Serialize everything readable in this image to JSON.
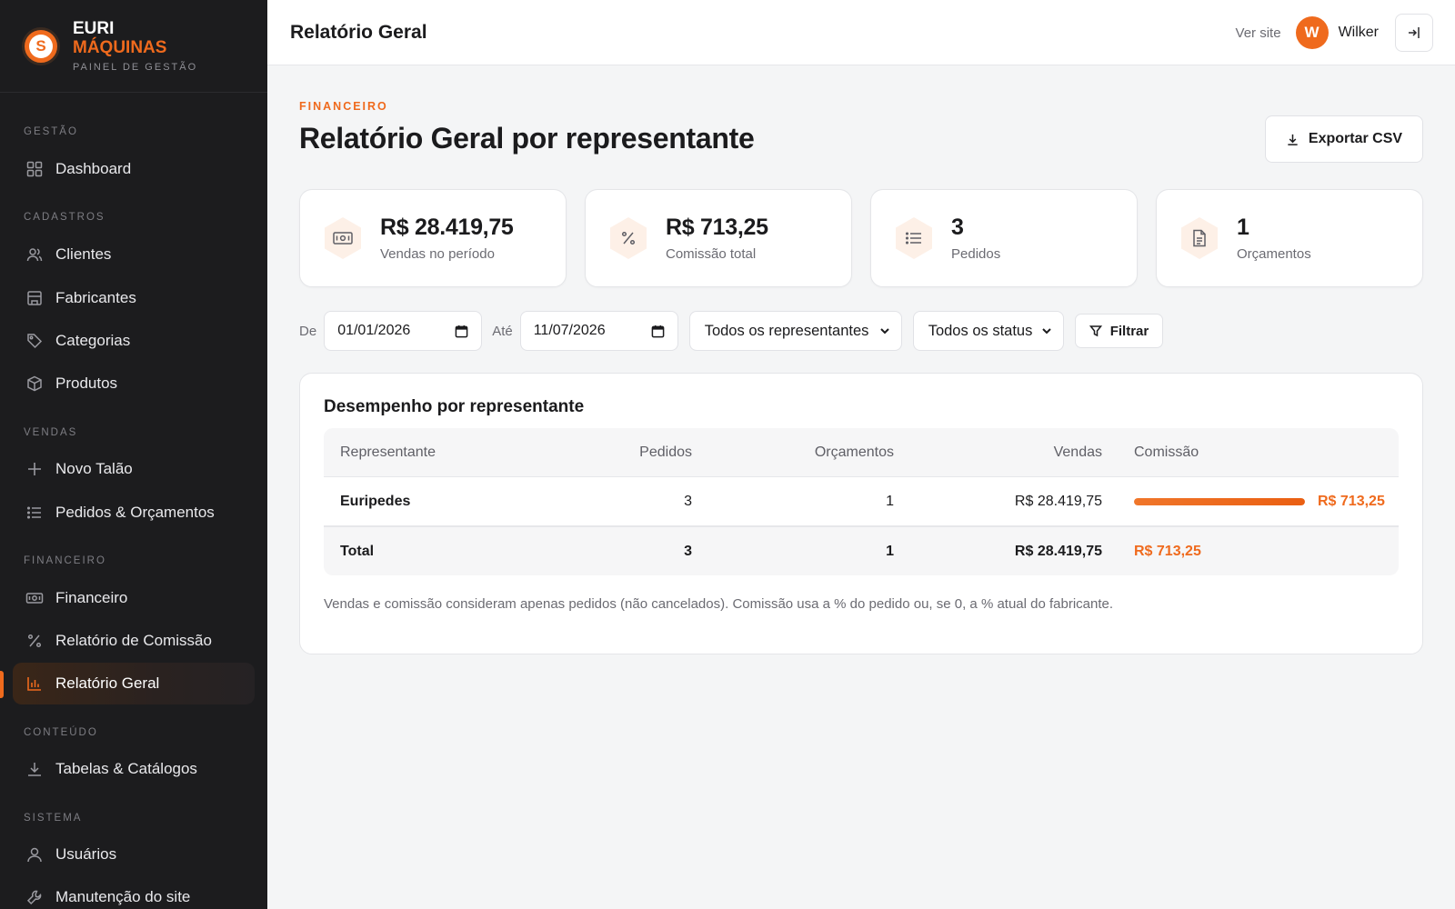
{
  "brand": {
    "line1": "EURI",
    "line2": "MÁQUINAS",
    "tagline": "PAINEL DE GESTÃO",
    "logo_letter": "S",
    "accent": "#ef6a1d"
  },
  "sidebar": {
    "sections": [
      {
        "label": "GESTÃO",
        "items": [
          {
            "label": "Dashboard",
            "icon": "grid-icon"
          }
        ]
      },
      {
        "label": "CADASTROS",
        "items": [
          {
            "label": "Clientes",
            "icon": "users-icon"
          },
          {
            "label": "Fabricantes",
            "icon": "building-icon"
          },
          {
            "label": "Categorias",
            "icon": "tag-icon"
          },
          {
            "label": "Produtos",
            "icon": "box-icon"
          }
        ]
      },
      {
        "label": "VENDAS",
        "items": [
          {
            "label": "Novo Talão",
            "icon": "plus-icon"
          },
          {
            "label": "Pedidos & Orçamentos",
            "icon": "list-icon"
          }
        ]
      },
      {
        "label": "FINANCEIRO",
        "items": [
          {
            "label": "Financeiro",
            "icon": "banknote-icon"
          },
          {
            "label": "Relatório de Comissão",
            "icon": "percent-icon"
          },
          {
            "label": "Relatório Geral",
            "icon": "bar-chart-icon",
            "active": true
          }
        ]
      },
      {
        "label": "CONTEÚDO",
        "items": [
          {
            "label": "Tabelas & Catálogos",
            "icon": "download-icon"
          }
        ]
      },
      {
        "label": "SISTEMA",
        "items": [
          {
            "label": "Usuários",
            "icon": "user-icon"
          },
          {
            "label": "Manutenção do site",
            "icon": "wrench-icon"
          }
        ]
      }
    ]
  },
  "topbar": {
    "title": "Relatório Geral",
    "view_site": "Ver site",
    "avatar_initial": "W",
    "user_name": "Wilker"
  },
  "header": {
    "eyebrow": "FINANCEIRO",
    "title": "Relatório Geral por representante",
    "export_label": "Exportar CSV"
  },
  "stats": [
    {
      "value": "R$ 28.419,75",
      "label": "Vendas no período",
      "icon": "banknote-icon"
    },
    {
      "value": "R$ 713,25",
      "label": "Comissão total",
      "icon": "percent-icon"
    },
    {
      "value": "3",
      "label": "Pedidos",
      "icon": "list-icon"
    },
    {
      "value": "1",
      "label": "Orçamentos",
      "icon": "document-icon"
    }
  ],
  "filters": {
    "from_label": "De",
    "from_value": "01/01/2026",
    "to_label": "Até",
    "to_value": "11/07/2026",
    "representative_selected": "Todos os representantes",
    "status_selected": "Todos os status",
    "filter_label": "Filtrar"
  },
  "performance": {
    "title": "Desempenho por representante",
    "columns": [
      "Representante",
      "Pedidos",
      "Orçamentos",
      "Vendas",
      "Comissão"
    ],
    "rows": [
      {
        "name": "Euripedes",
        "orders": "3",
        "quotes": "1",
        "sales": "R$ 28.419,75",
        "commission": "R$ 713,25",
        "commission_share": 1.0
      }
    ],
    "total": {
      "label": "Total",
      "orders": "3",
      "quotes": "1",
      "sales": "R$ 28.419,75",
      "commission": "R$ 713,25"
    },
    "note": "Vendas e comissão consideram apenas pedidos (não cancelados). Comissão usa a % do pedido ou, se 0, a % atual do fabricante."
  }
}
